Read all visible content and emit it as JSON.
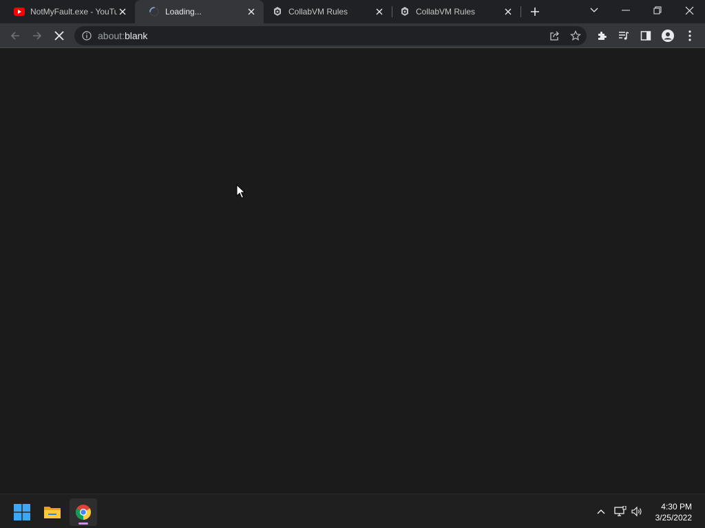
{
  "tabs": [
    {
      "title": "NotMyFault.exe - YouTube",
      "favicon": "youtube-icon",
      "active": false
    },
    {
      "title": "Loading...",
      "favicon": "loading-spinner-icon",
      "active": true
    },
    {
      "title": "CollabVM Rules",
      "favicon": "collabvm-icon",
      "active": false
    },
    {
      "title": "CollabVM Rules",
      "favicon": "collabvm-icon",
      "active": false
    }
  ],
  "omnibox": {
    "scheme": "about:",
    "host": "blank"
  },
  "taskbar": {
    "apps": [
      "windows-start-icon",
      "file-explorer-icon",
      "chrome-icon"
    ],
    "time": "4:30 PM",
    "date": "3/25/2022"
  },
  "colors": {
    "youtube_red": "#ff0000",
    "accent_indicator": "#c995e0"
  }
}
